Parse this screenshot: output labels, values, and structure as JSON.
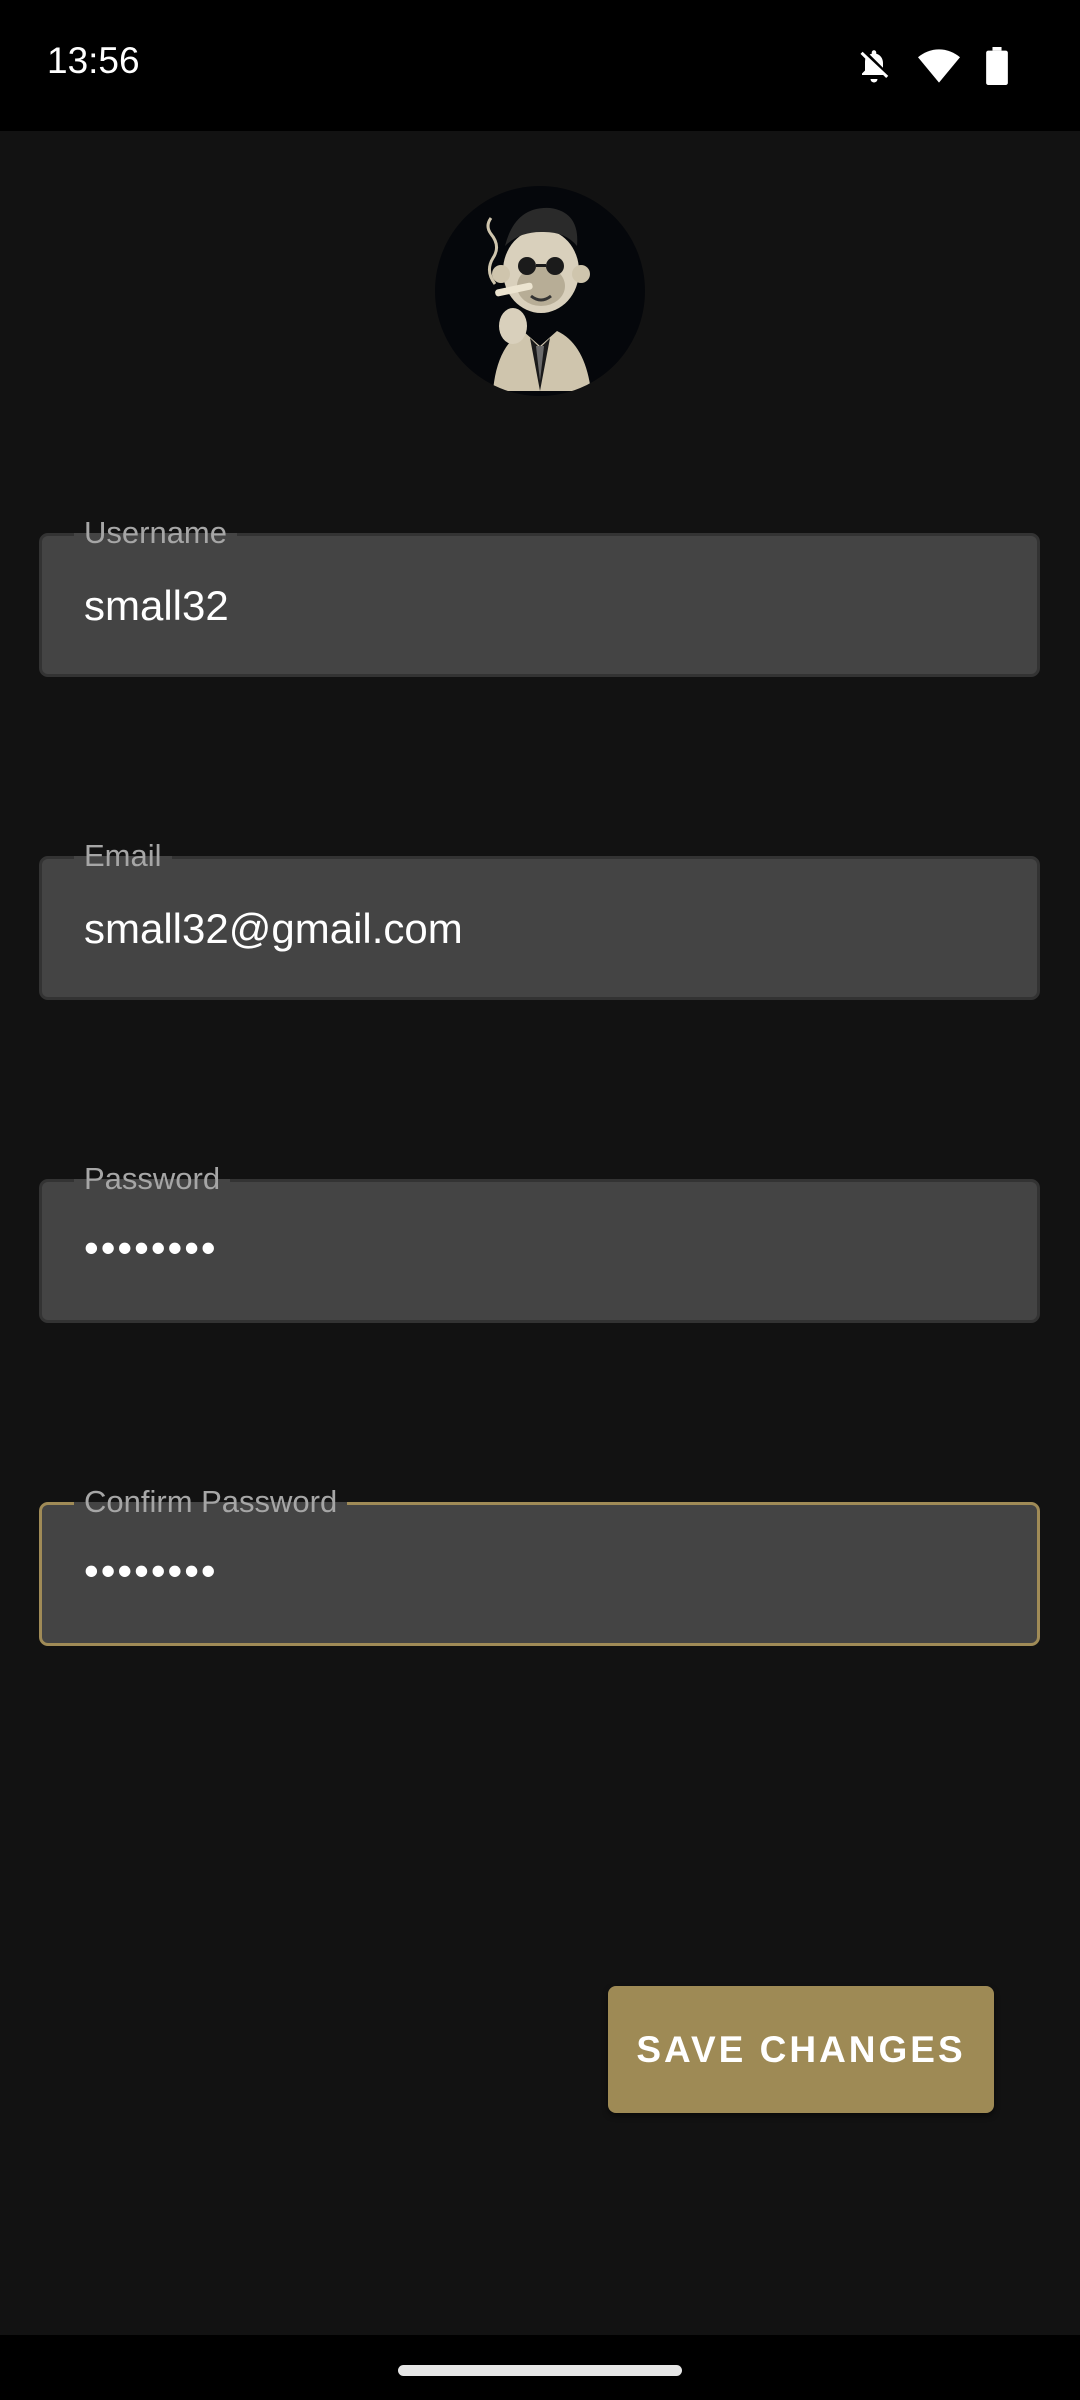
{
  "status_bar": {
    "time": "13:56",
    "icons": [
      "notifications-off-icon",
      "wifi-icon",
      "battery-icon"
    ]
  },
  "profile": {
    "avatar": "monkey-smoking-cigar-avatar"
  },
  "form": {
    "username": {
      "label": "Username",
      "value": "small32"
    },
    "email": {
      "label": "Email",
      "value": "small32@gmail.com"
    },
    "password": {
      "label": "Password",
      "value": "••••••••"
    },
    "confirm_password": {
      "label": "Confirm Password",
      "value": "••••••••"
    }
  },
  "actions": {
    "save_label": "SAVE CHANGES"
  },
  "colors": {
    "background": "#121212",
    "field_background": "#444444",
    "accent": "#9e8a55",
    "focused_border": "#a08b57"
  }
}
